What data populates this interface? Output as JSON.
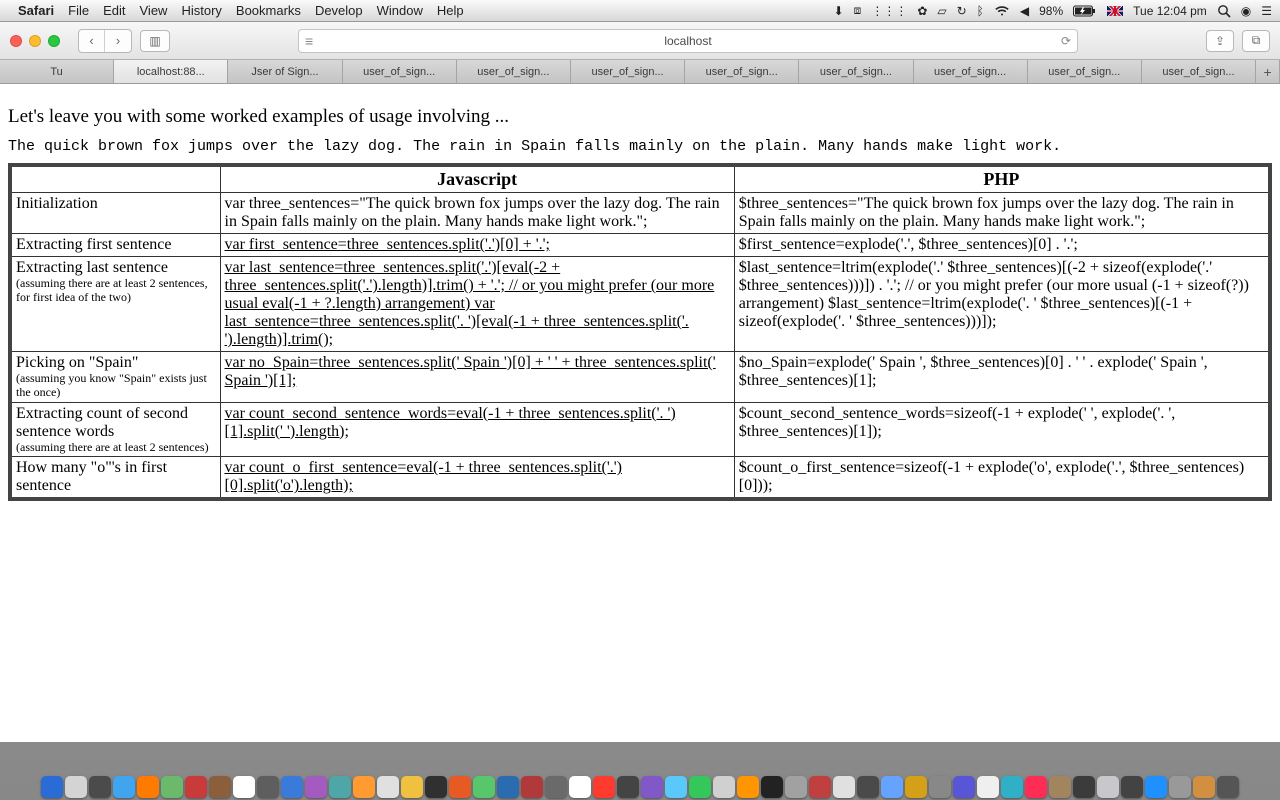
{
  "menubar": {
    "app": "Safari",
    "items": [
      "File",
      "Edit",
      "View",
      "History",
      "Bookmarks",
      "Develop",
      "Window",
      "Help"
    ],
    "battery": "98%",
    "clock": "Tue 12:04 pm"
  },
  "toolbar": {
    "url": "localhost"
  },
  "tabs": [
    "Tu",
    "localhost:88...",
    "Jser of Sign...",
    "user_of_sign...",
    "user_of_sign...",
    "user_of_sign...",
    "user_of_sign...",
    "user_of_sign...",
    "user_of_sign...",
    "user_of_sign...",
    "user_of_sign..."
  ],
  "page": {
    "intro": "Let's leave you with some worked examples of usage involving ...",
    "sample": "The quick brown fox jumps over the lazy dog. The rain in Spain falls mainly on the plain. Many hands make light work.",
    "headers": [
      "",
      "Javascript",
      "PHP"
    ],
    "rows": [
      {
        "label": "Initialization",
        "note": "",
        "js": "var three_sentences=\"The quick brown fox jumps over the lazy dog. The rain in Spain falls mainly on the plain. Many hands make light work.\";",
        "php": "$three_sentences=\"The quick brown fox jumps over the lazy dog. The rain in Spain falls mainly on the plain. Many hands make light work.\";",
        "jslink": false
      },
      {
        "label": "Extracting first sentence",
        "note": "",
        "js": "var first_sentence=three_sentences.split('.')[0] + '.';",
        "php": "$first_sentence=explode('.', $three_sentences)[0] . '.';",
        "jslink": true
      },
      {
        "label": "Extracting last sentence",
        "note": "(assuming there are at least 2 sentences, for first idea of the two)",
        "js": "var last_sentence=three_sentences.split('.')[eval(-2 + three_sentences.split('.').length)].trim() + '.'; // or you might prefer (our more usual eval(-1 + ?.length) arrangement) var last_sentence=three_sentences.split('. ')[eval(-1 + three_sentences.split('. ').length)].trim();",
        "php": "$last_sentence=ltrim(explode('.' $three_sentences)[(-2 + sizeof(explode('.' $three_sentences)))]) . '.'; // or you might prefer (our more usual (-1 + sizeof(?)) arrangement) $last_sentence=ltrim(explode('. ' $three_sentences)[(-1 + sizeof(explode('. ' $three_sentences)))]);",
        "jslink": true
      },
      {
        "label": "Picking on \"Spain\"",
        "note": "(assuming you know \"Spain\" exists just the once)",
        "js": "var no_Spain=three_sentences.split(' Spain ')[0] + ' ' + three_sentences.split(' Spain ')[1];",
        "php": "$no_Spain=explode(' Spain ', $three_sentences)[0] . ' ' . explode(' Spain ', $three_sentences)[1];",
        "jslink": true
      },
      {
        "label": "Extracting count of second sentence words",
        "note": "(assuming there are at least 2 sentences)",
        "js": "var count_second_sentence_words=eval(-1 + three_sentences.split('. ')[1].split(' ').length);",
        "php": "$count_second_sentence_words=sizeof(-1 + explode(' ', explode('. ', $three_sentences)[1]);",
        "jslink": true
      },
      {
        "label": "How many \"o\"'s in first sentence",
        "note": "",
        "js": "var count_o_first_sentence=eval(-1 + three_sentences.split('.')[0].split('o').length);",
        "php": "$count_o_first_sentence=sizeof(-1 + explode('o', explode('.', $three_sentences)[0]));",
        "jslink": true
      }
    ]
  }
}
